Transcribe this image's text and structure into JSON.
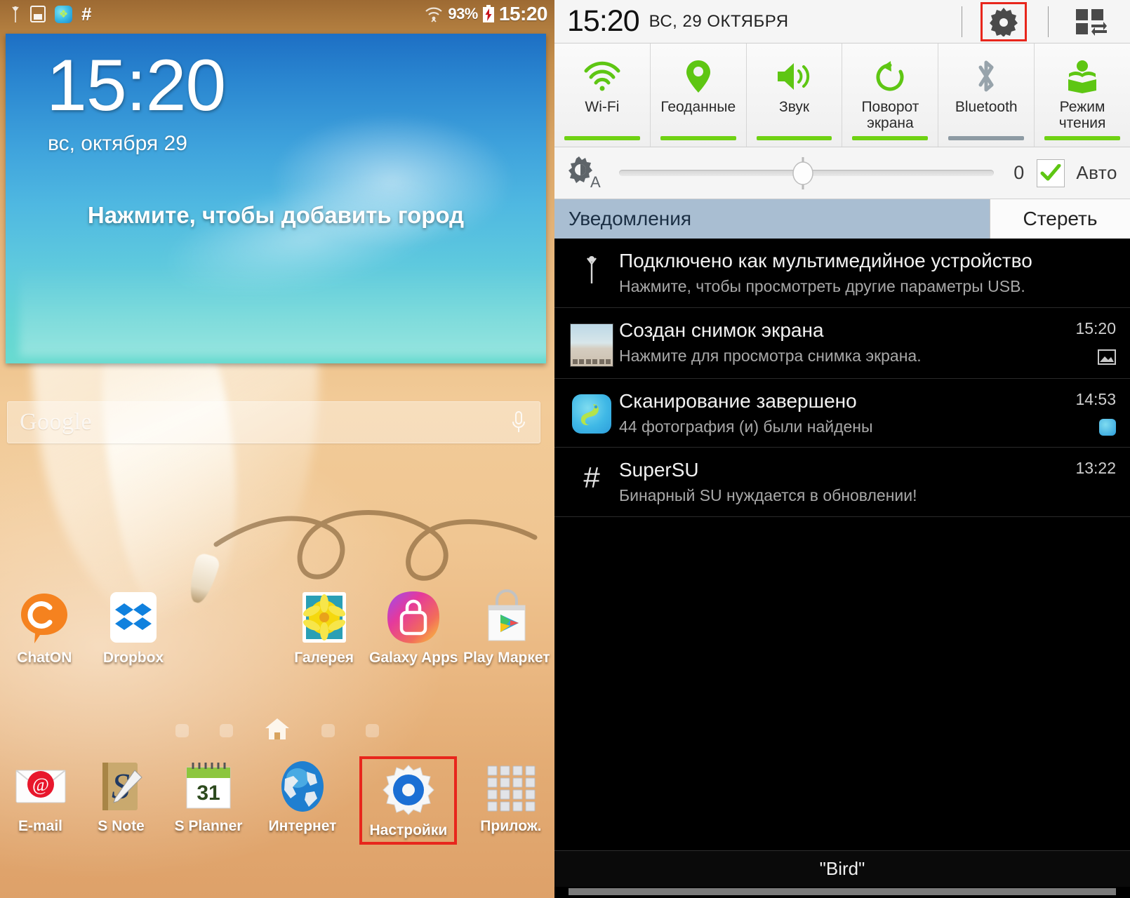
{
  "home": {
    "statusbar": {
      "icons_left": [
        "usb-icon",
        "screenshot-icon",
        "gallery-scan-icon",
        "supersu-hash-icon"
      ],
      "hash_glyph": "#",
      "wifi_icon": "wifi-icon",
      "battery_percent": "93%",
      "battery_icon": "battery-charging-icon",
      "time": "15:20"
    },
    "clock_widget": {
      "time": "15:20",
      "date": "вс, октября 29",
      "city_prompt": "Нажмите, чтобы добавить город"
    },
    "search": {
      "brand": "Google",
      "placeholder": "Google",
      "mic_icon": "microphone-icon"
    },
    "apps_row": [
      {
        "label": "ChatON",
        "icon": "chaton-icon"
      },
      {
        "label": "Dropbox",
        "icon": "dropbox-icon"
      },
      {
        "label": "Галерея",
        "icon": "gallery-icon"
      },
      {
        "label": "Galaxy Apps",
        "icon": "galaxy-apps-icon"
      },
      {
        "label": "Play Маркет",
        "icon": "play-store-icon"
      }
    ],
    "page_indicator": {
      "count": 5,
      "home_index": 2,
      "home_icon": "house-icon"
    },
    "dock": [
      {
        "label": "E-mail",
        "icon": "email-icon",
        "selected": false
      },
      {
        "label": "S Note",
        "icon": "s-note-icon",
        "selected": false
      },
      {
        "label": "S Planner",
        "icon": "calendar-icon",
        "day": "31",
        "selected": false
      },
      {
        "label": "Интернет",
        "icon": "browser-globe-icon",
        "selected": false
      },
      {
        "label": "Настройки",
        "icon": "settings-gear-icon",
        "selected": true
      },
      {
        "label": "Прилож.",
        "icon": "apps-grid-icon",
        "selected": false
      }
    ]
  },
  "panel": {
    "header": {
      "time": "15:20",
      "date": "ВС, 29 ОКТЯБРЯ",
      "settings_icon": "gear-icon",
      "settings_highlighted": true,
      "quick_toggle_icon": "quick-settings-grid-icon"
    },
    "toggles": [
      {
        "label": "Wi-Fi",
        "icon": "wifi-icon",
        "on": true
      },
      {
        "label": "Геоданные",
        "icon": "location-pin-icon",
        "on": true
      },
      {
        "label": "Звук",
        "icon": "volume-icon",
        "on": true
      },
      {
        "label": "Поворот\nэкрана",
        "icon": "rotate-icon",
        "on": true
      },
      {
        "label": "Bluetooth",
        "icon": "bluetooth-icon",
        "on": false
      },
      {
        "label": "Режим\nчтения",
        "icon": "reading-mode-icon",
        "on": true
      }
    ],
    "brightness": {
      "icon": "brightness-auto-icon",
      "value": "0",
      "auto_label": "Авто",
      "auto_checked": true,
      "slider_percent": 49
    },
    "notifications_header": {
      "title": "Уведомления",
      "clear_label": "Стереть"
    },
    "notifications": [
      {
        "icon": "usb-icon",
        "title": "Подключено как мультимедийное устройство",
        "subtitle": "Нажмите, чтобы просмотреть другие параметры USB.",
        "time": "",
        "badge": ""
      },
      {
        "icon": "screenshot-thumbnail",
        "title": "Создан снимок экрана",
        "subtitle": "Нажмите для просмотра снимка экрана.",
        "time": "15:20",
        "badge": "image-icon"
      },
      {
        "icon": "gallery-scan-icon",
        "title": "Сканирование завершено",
        "subtitle": "44 фотография (и) были найдены",
        "time": "14:53",
        "badge": "gallery-scan-icon"
      },
      {
        "icon": "supersu-hash-icon",
        "title": "SuperSU",
        "subtitle": "Бинарный SU нуждается в обновлении!",
        "time": "13:22",
        "badge": ""
      }
    ],
    "footer": {
      "caption": "\"Bird\""
    }
  },
  "colors": {
    "accent_green": "#6fd213",
    "highlight_red": "#e8261c",
    "toggle_off_gray": "#8d9aa3",
    "notif_header_blue": "#a9bed2",
    "panel_bg": "#000000"
  }
}
